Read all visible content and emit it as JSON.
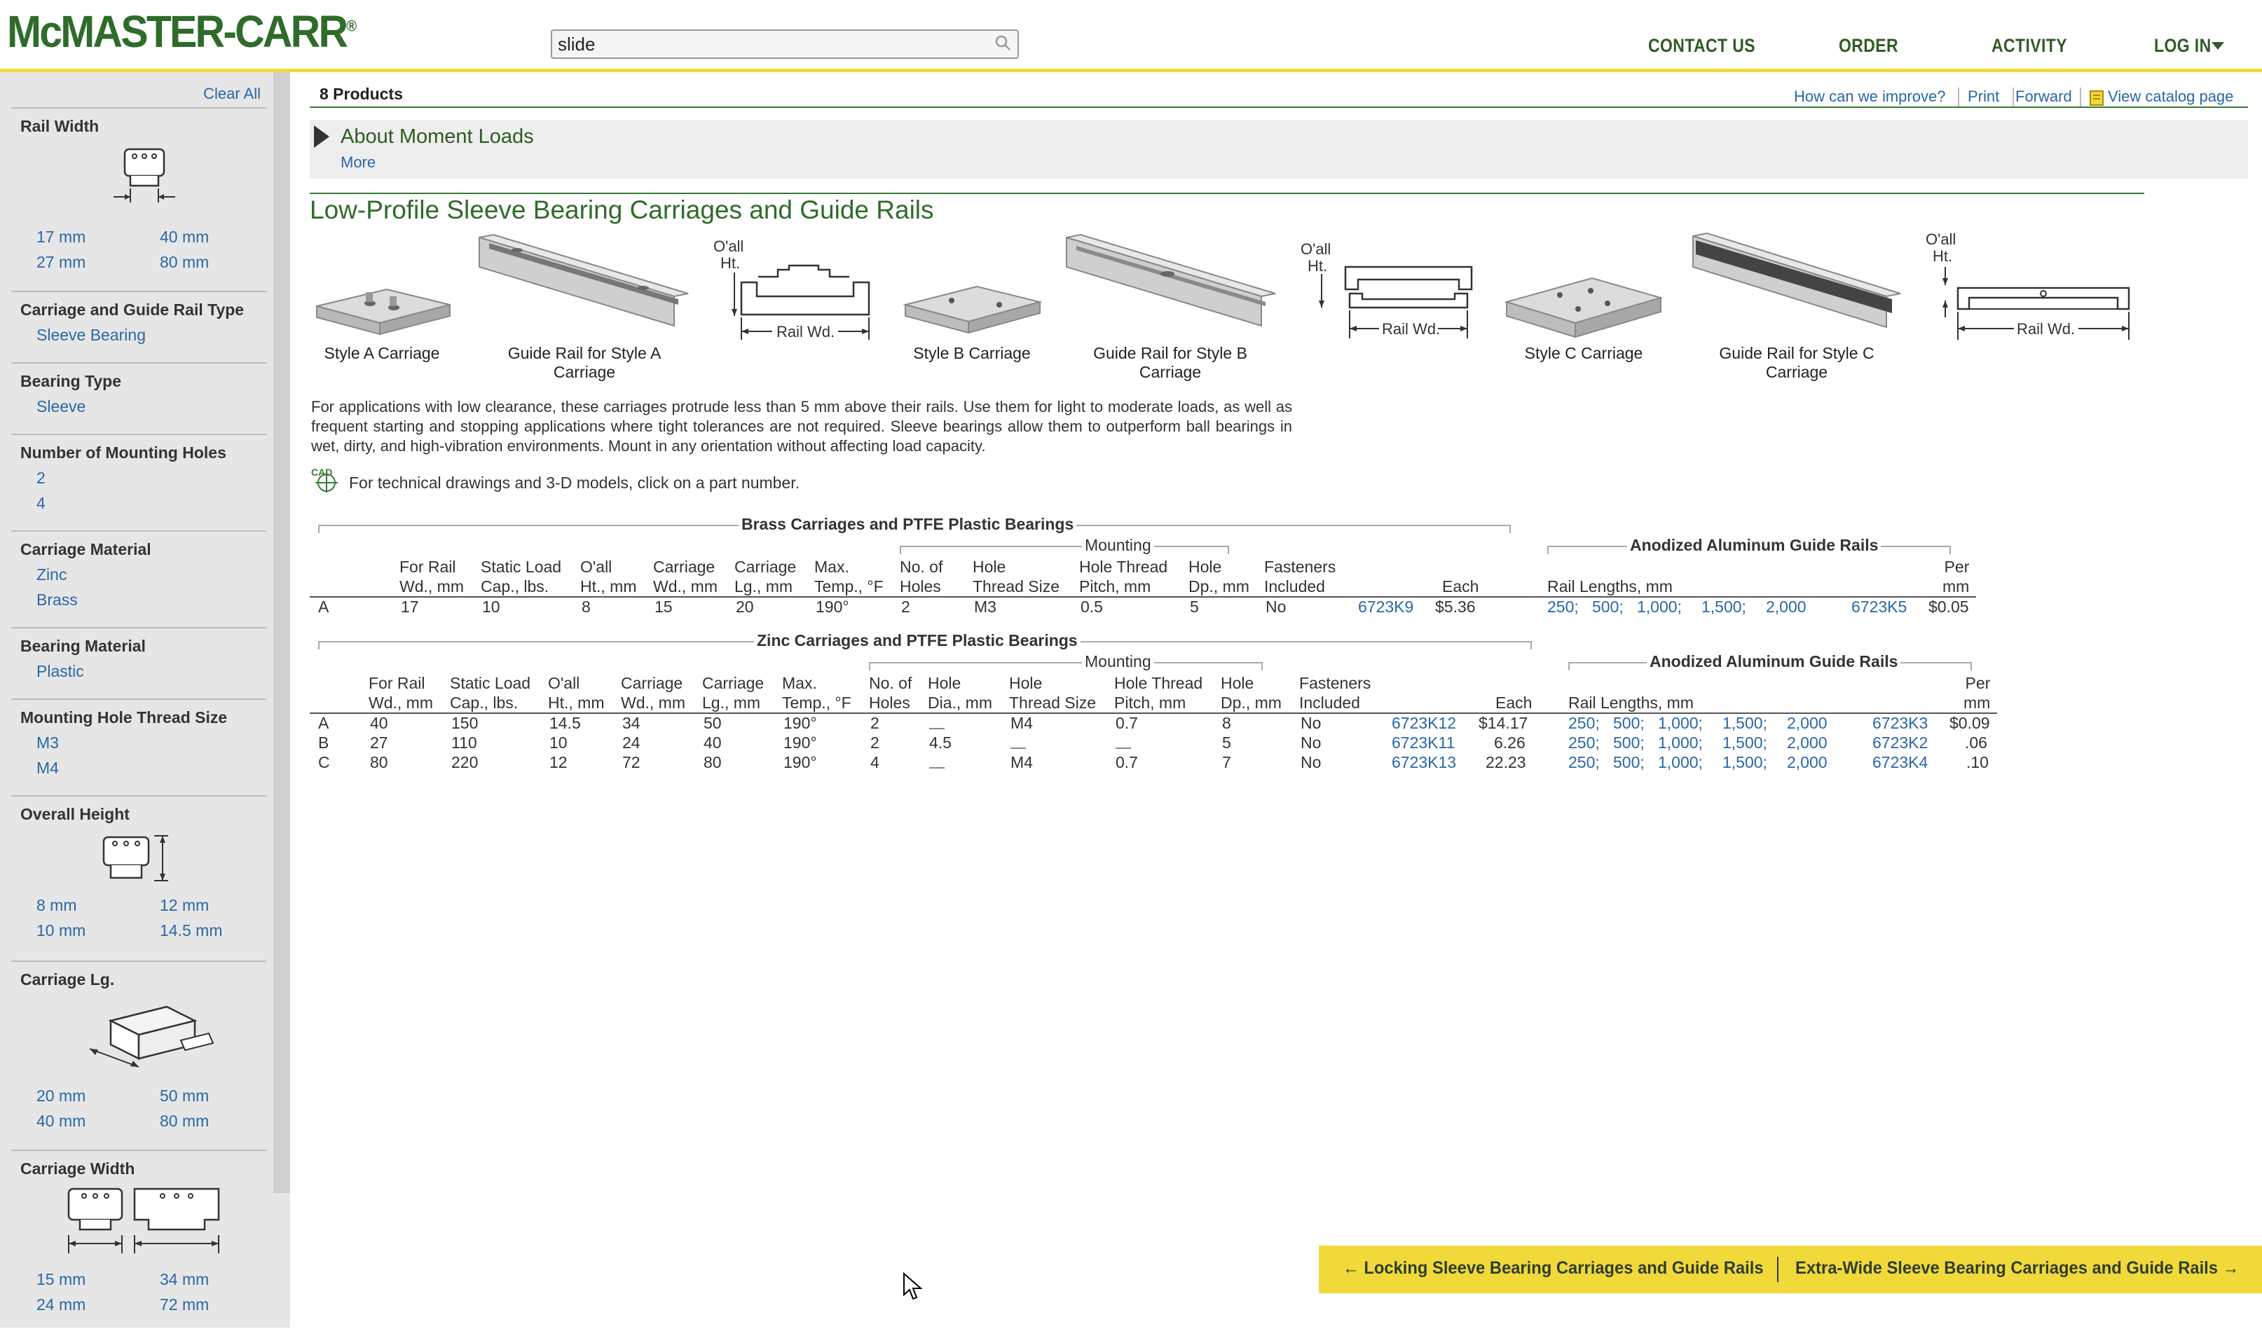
{
  "header": {
    "logo": "McMASTER-CARR",
    "logo_mark": "®",
    "search_value": "slide",
    "nav": [
      "CONTACT US",
      "ORDER",
      "ACTIVITY",
      "LOG IN"
    ]
  },
  "sidebar": {
    "clear_all": "Clear All",
    "facets": [
      {
        "title": "Rail Width",
        "options": [
          "17 mm",
          "40 mm",
          "27 mm",
          "80 mm"
        ]
      },
      {
        "title": "Carriage and Guide Rail Type",
        "options": [
          "Sleeve Bearing"
        ]
      },
      {
        "title": "Bearing Type",
        "options": [
          "Sleeve"
        ]
      },
      {
        "title": "Number of Mounting Holes",
        "options": [
          "2",
          "4"
        ]
      },
      {
        "title": "Carriage Material",
        "options": [
          "Zinc",
          "Brass"
        ]
      },
      {
        "title": "Bearing Material",
        "options": [
          "Plastic"
        ]
      },
      {
        "title": "Mounting Hole Thread Size",
        "options": [
          "M3",
          "M4"
        ]
      },
      {
        "title": "Overall Height",
        "options": [
          "8 mm",
          "12 mm",
          "10 mm",
          "14.5 mm"
        ]
      },
      {
        "title": "Carriage Lg.",
        "options": [
          "20 mm",
          "50 mm",
          "40 mm",
          "80 mm"
        ]
      },
      {
        "title": "Carriage Width",
        "options": [
          "15 mm",
          "34 mm",
          "24 mm",
          "72 mm"
        ]
      }
    ]
  },
  "main": {
    "products_count": "8 Products",
    "toplinks": [
      "How can we improve?",
      "Print",
      "Forward",
      "View catalog page"
    ],
    "about_title": "About Moment Loads",
    "about_more": "More",
    "section_title": "Low-Profile Sleeve Bearing Carriages and Guide Rails",
    "captions": [
      "Style A Carriage",
      "Guide Rail for Style A Carriage",
      "Style B Carriage",
      "Guide Rail for Style B Carriage",
      "Style C Carriage",
      "Guide Rail for Style C Carriage"
    ],
    "diagram_labels": {
      "oall": "O'all",
      "ht": "Ht.",
      "rail_wd": "Rail Wd."
    },
    "description": "For applications with low clearance, these carriages protrude less than 5 mm above their rails. Use them for light to moderate loads, as well as frequent starting and stopping applications where tight tolerances are not required. Sleeve bearings allow them to outperform ball bearings in wet, dirty, and high-vibration environments. Mount in any orientation without affecting load capacity.",
    "cad_label": "CAD",
    "cad_note": "For technical drawings and 3-D models, click on a part number."
  },
  "brass_table": {
    "title": "Brass Carriages and PTFE Plastic Bearings",
    "mounting": "Mounting",
    "rail_group": "Anodized Aluminum Guide Rails",
    "headers": {
      "rail_wd": [
        "For Rail",
        "Wd., mm"
      ],
      "static": [
        "Static Load",
        "Cap., lbs."
      ],
      "oall": [
        "O'all",
        "Ht., mm"
      ],
      "cwd": [
        "Carriage",
        "Wd., mm"
      ],
      "clg": [
        "Carriage",
        "Lg., mm"
      ],
      "temp": [
        "Max.",
        "Temp., °F"
      ],
      "holes": [
        "No. of",
        "Holes"
      ],
      "thread": [
        "Hole",
        "Thread Size"
      ],
      "pitch": [
        "Hole Thread",
        "Pitch, mm"
      ],
      "dp": [
        "Hole",
        "Dp., mm"
      ],
      "fast": [
        "Fasteners",
        "Included"
      ],
      "each": "Each",
      "lengths": "Rail Lengths, mm",
      "per": [
        "Per",
        "mm"
      ]
    },
    "rows": [
      {
        "style": "A",
        "rail_wd": "17",
        "static": "10",
        "oall": "8",
        "cwd": "15",
        "clg": "20",
        "temp": "190°",
        "holes": "2",
        "thread": "M3",
        "pitch": "0.5",
        "dp": "5",
        "fast": "No",
        "part": "6723K9",
        "each": "$5.36",
        "lengths": [
          "250;",
          "500;",
          "1,000;",
          "1,500;",
          "2,000"
        ],
        "rail_part": "6723K5",
        "per": "$0.05"
      }
    ]
  },
  "zinc_table": {
    "title": "Zinc Carriages and PTFE Plastic Bearings",
    "mounting": "Mounting",
    "rail_group": "Anodized Aluminum Guide Rails",
    "headers": {
      "rail_wd": [
        "For Rail",
        "Wd., mm"
      ],
      "static": [
        "Static Load",
        "Cap., lbs."
      ],
      "oall": [
        "O'all",
        "Ht., mm"
      ],
      "cwd": [
        "Carriage",
        "Wd., mm"
      ],
      "clg": [
        "Carriage",
        "Lg., mm"
      ],
      "temp": [
        "Max.",
        "Temp., °F"
      ],
      "holes": [
        "No. of",
        "Holes"
      ],
      "dia": [
        "Hole",
        "Dia., mm"
      ],
      "thread": [
        "Hole",
        "Thread Size"
      ],
      "pitch": [
        "Hole Thread",
        "Pitch, mm"
      ],
      "dp": [
        "Hole",
        "Dp., mm"
      ],
      "fast": [
        "Fasteners",
        "Included"
      ],
      "each": "Each",
      "lengths": "Rail Lengths, mm",
      "per": [
        "Per",
        "mm"
      ]
    },
    "rows": [
      {
        "style": "A",
        "rail_wd": "40",
        "static": "150",
        "oall": "14.5",
        "cwd": "34",
        "clg": "50",
        "temp": "190°",
        "holes": "2",
        "dia": "",
        "thread": "M4",
        "pitch": "0.7",
        "dp": "8",
        "fast": "No",
        "part": "6723K12",
        "each": "$14.17",
        "lengths": [
          "250;",
          "500;",
          "1,000;",
          "1,500;",
          "2,000"
        ],
        "rail_part": "6723K3",
        "per": "$0.09"
      },
      {
        "style": "B",
        "rail_wd": "27",
        "static": "110",
        "oall": "10",
        "cwd": "24",
        "clg": "40",
        "temp": "190°",
        "holes": "2",
        "dia": "4.5",
        "thread": "",
        "pitch": "",
        "dp": "5",
        "fast": "No",
        "part": "6723K11",
        "each": "6.26",
        "lengths": [
          "250;",
          "500;",
          "1,000;",
          "1,500;",
          "2,000"
        ],
        "rail_part": "6723K2",
        "per": ".06"
      },
      {
        "style": "C",
        "rail_wd": "80",
        "static": "220",
        "oall": "12",
        "cwd": "72",
        "clg": "80",
        "temp": "190°",
        "holes": "4",
        "dia": "",
        "thread": "M4",
        "pitch": "0.7",
        "dp": "7",
        "fast": "No",
        "part": "6723K13",
        "each": "22.23",
        "lengths": [
          "250;",
          "500;",
          "1,000;",
          "1,500;",
          "2,000"
        ],
        "rail_part": "6723K4",
        "per": ".10"
      }
    ]
  },
  "bottom_nav": {
    "prev": "← Locking Sleeve Bearing Carriages and Guide Rails",
    "next": "Extra-Wide Sleeve Bearing Carriages and Guide Rails →"
  },
  "colors": {
    "accent_yellow": "#f2d93a",
    "brand_green": "#2f6b2a",
    "link_blue": "#2a67a6"
  }
}
